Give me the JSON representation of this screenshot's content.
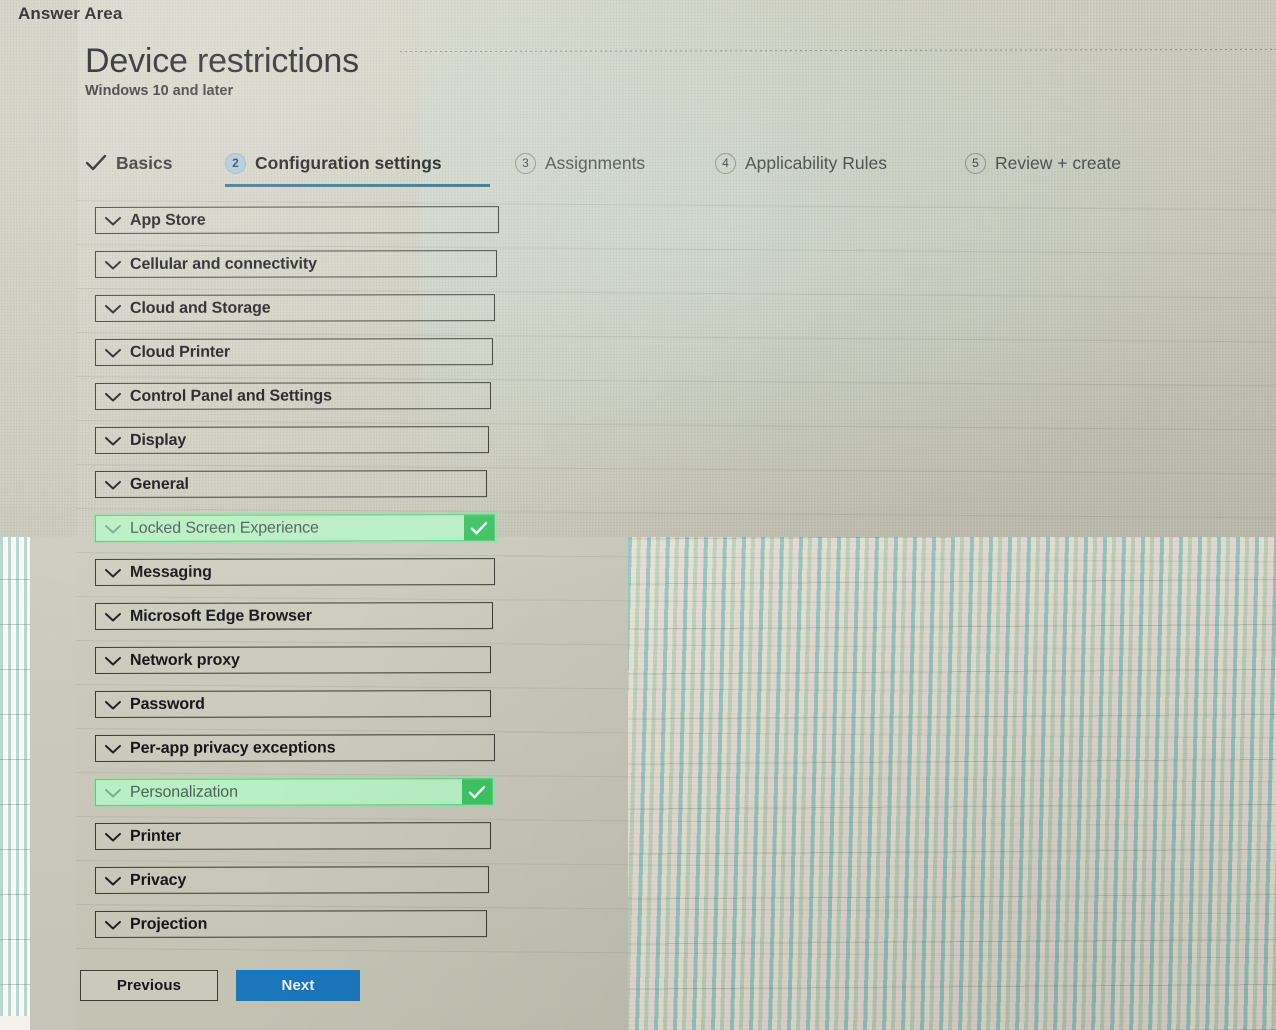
{
  "answer_area_label": "Answer Area",
  "page": {
    "title": "Device restrictions",
    "subtitle": "Windows 10 and later"
  },
  "wizard": {
    "steps": [
      {
        "badge": "check",
        "label": "Basics",
        "state": "done"
      },
      {
        "badge": "2",
        "label": "Configuration settings",
        "state": "active"
      },
      {
        "badge": "3",
        "label": "Assignments",
        "state": "todo"
      },
      {
        "badge": "4",
        "label": "Applicability Rules",
        "state": "todo"
      },
      {
        "badge": "5",
        "label": "Review + create",
        "state": "todo"
      }
    ]
  },
  "settings_list": [
    {
      "label": "App Store",
      "highlighted": false
    },
    {
      "label": "Cellular and connectivity",
      "highlighted": false
    },
    {
      "label": "Cloud and Storage",
      "highlighted": false
    },
    {
      "label": "Cloud Printer",
      "highlighted": false
    },
    {
      "label": "Control Panel and Settings",
      "highlighted": false
    },
    {
      "label": "Display",
      "highlighted": false
    },
    {
      "label": "General",
      "highlighted": false
    },
    {
      "label": "Locked Screen Experience",
      "highlighted": true
    },
    {
      "label": "Messaging",
      "highlighted": false
    },
    {
      "label": "Microsoft Edge Browser",
      "highlighted": false
    },
    {
      "label": "Network proxy",
      "highlighted": false
    },
    {
      "label": "Password",
      "highlighted": false
    },
    {
      "label": "Per-app privacy exceptions",
      "highlighted": false
    },
    {
      "label": "Personalization",
      "highlighted": true
    },
    {
      "label": "Printer",
      "highlighted": false
    },
    {
      "label": "Privacy",
      "highlighted": false
    },
    {
      "label": "Projection",
      "highlighted": false
    }
  ],
  "footer": {
    "previous_label": "Previous",
    "next_label": "Next"
  },
  "colors": {
    "accent_blue": "#1b76bc",
    "active_step_underline": "#2d6f8e",
    "highlight_green_fill": "#b9efc4",
    "highlight_green_border": "#58cc7e",
    "check_badge_green": "#3ec463",
    "page_background": "#c9c8b9"
  }
}
